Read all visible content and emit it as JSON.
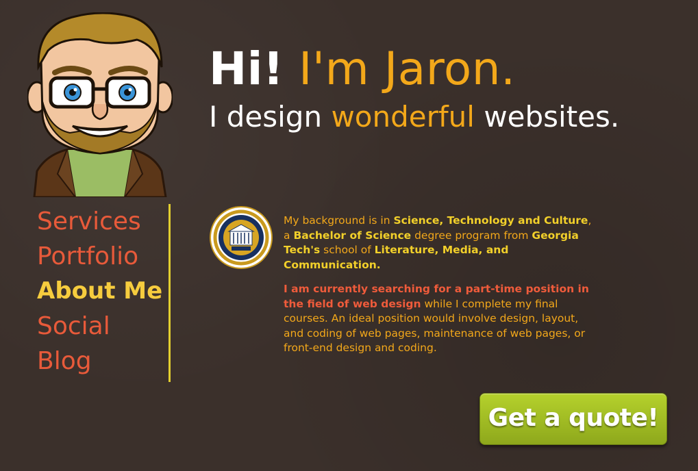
{
  "header": {
    "greeting": "Hi!",
    "name": "I'm Jaron.",
    "tagline_start": "I design",
    "tagline_accent": "wonderful",
    "tagline_end": "websites."
  },
  "nav": {
    "items": [
      {
        "label": "Services"
      },
      {
        "label": "Portfolio"
      },
      {
        "label": "About Me",
        "active": true
      },
      {
        "label": "Social"
      },
      {
        "label": "Blog"
      }
    ]
  },
  "about": {
    "p1": {
      "t1": "My background is in ",
      "b1": "Science, Technology and Culture",
      "t2": ", a ",
      "b2": "Bachelor of Science",
      "t3": " degree program from ",
      "b3": "Georgia Tech's",
      "t4": " school of ",
      "b4": "Literature, Media, and Communication."
    },
    "p2": {
      "highlight": "I am currently searching for a part-time position in the field of web design",
      "rest": " while I complete my final courses.  An ideal position would involve design, layout, and coding of web pages, maintenance of web pages, or front-end design and coding."
    }
  },
  "cta": {
    "label": "Get a quote!"
  },
  "colors": {
    "background": "#3b302b",
    "accent_orange": "#f3a81a",
    "nav_red": "#e85a3a",
    "active_yellow": "#f6cc3e",
    "button_green": "#a4c124"
  },
  "icons": {
    "avatar": "cartoon-avatar-icon",
    "seal": "georgia-tech-seal-icon"
  }
}
